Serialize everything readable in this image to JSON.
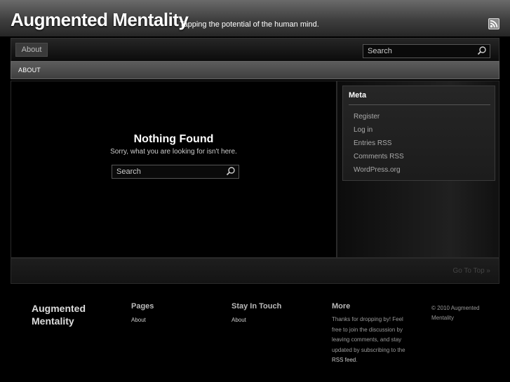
{
  "header": {
    "title": "Augmented Mentality",
    "tagline": "Tapping the potential of the human mind."
  },
  "topnav": {
    "tab_about": "About",
    "search_placeholder": "Search"
  },
  "subnav": {
    "item_about": "ABOUT"
  },
  "main": {
    "title": "Nothing Found",
    "message": "Sorry, what you are looking for isn't here.",
    "search_placeholder": "Search"
  },
  "sidebar": {
    "widget_title": "Meta",
    "items": [
      "Register",
      "Log in",
      "Entries RSS",
      "Comments RSS",
      "WordPress.org"
    ]
  },
  "footbar": {
    "goto_top": "Go To Top »"
  },
  "footer": {
    "brand": "Augmented Mentality",
    "pages_heading": "Pages",
    "pages_link": "About",
    "stay_heading": "Stay In Touch",
    "stay_link": "About",
    "more_heading": "More",
    "more_text": "Thanks for dropping by! Feel free to join the discussion by leaving comments, and stay updated by subscribing to the",
    "more_rss_link": "RSS feed",
    "more_end": ".",
    "copyright": "© 2010 Augmented Mentality"
  },
  "colors": {
    "background": "#000000",
    "header_top": "#6a6a6a",
    "subnav": "#4d4d4d",
    "rss_orange": "#f38b1f"
  }
}
